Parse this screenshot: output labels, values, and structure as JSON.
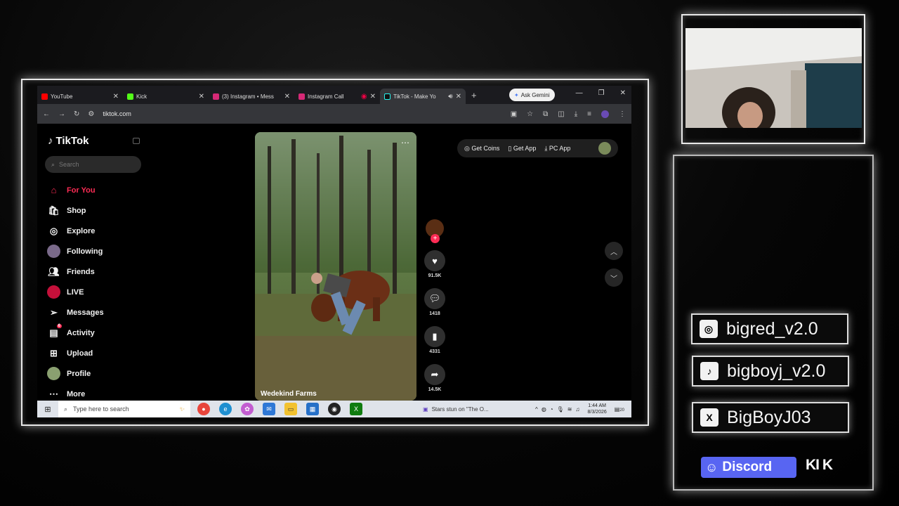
{
  "browser": {
    "tabs": [
      {
        "label": "YouTube",
        "color": "#ff0000"
      },
      {
        "label": "Kick",
        "color": "#53fc18"
      },
      {
        "label": "(3) Instagram • Mess",
        "color": "#d62976"
      },
      {
        "label": "Instagram Call",
        "color": "#d62976"
      },
      {
        "label": "TikTok - Make Yo",
        "color": "#25f4ee"
      }
    ],
    "gemini_label": "Ask Gemini",
    "url": "tiktok.com"
  },
  "tiktok": {
    "brand": "TikTok",
    "search_placeholder": "Search",
    "nav": [
      {
        "label": "For You",
        "icon": "home-icon"
      },
      {
        "label": "Shop",
        "icon": "shop-icon"
      },
      {
        "label": "Explore",
        "icon": "compass-icon"
      },
      {
        "label": "Following",
        "icon": "following-avatar-icon"
      },
      {
        "label": "Friends",
        "icon": "friends-icon"
      },
      {
        "label": "LIVE",
        "icon": "live-icon"
      },
      {
        "label": "Messages",
        "icon": "messages-icon"
      },
      {
        "label": "Activity",
        "icon": "activity-icon",
        "badge": "6"
      },
      {
        "label": "Upload",
        "icon": "upload-icon"
      },
      {
        "label": "Profile",
        "icon": "profile-icon"
      },
      {
        "label": "More",
        "icon": "more-icon"
      }
    ],
    "video": {
      "caption": "Wedekind Farms"
    },
    "actions": {
      "likes": "91.5K",
      "comments": "1418",
      "saves": "4331",
      "shares": "14.5K"
    },
    "top_buttons": {
      "coins": "Get Coins",
      "app": "Get App",
      "pc_app": "PC App"
    }
  },
  "taskbar": {
    "search_placeholder": "Type here to search",
    "news": "Stars stun on \"The O...",
    "time": "1:44 AM",
    "date": "8/3/2026",
    "notif_count": "20"
  },
  "overlay": {
    "instagram": "bigred_v2.0",
    "tiktok": "bigboyj_v2.0",
    "x": "BigBoyJ03",
    "discord": "Discord",
    "kick": "KI K"
  }
}
